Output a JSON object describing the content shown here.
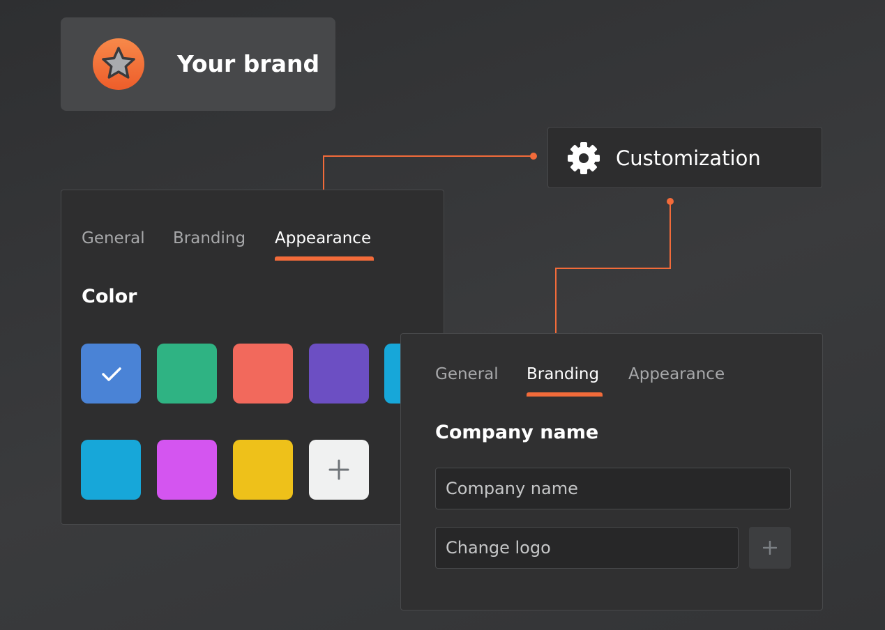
{
  "brand": {
    "name": "Your brand",
    "logo_icon": "star-icon",
    "logo_color": "#f26b3a"
  },
  "customization": {
    "label": "Customization",
    "icon": "gear-icon"
  },
  "accent_color": "#f26b3a",
  "appearance_panel": {
    "tabs": [
      {
        "label": "General",
        "active": false
      },
      {
        "label": "Branding",
        "active": false
      },
      {
        "label": "Appearance",
        "active": true
      }
    ],
    "section_title": "Color",
    "swatches": [
      {
        "color": "#4a83d6",
        "selected": true
      },
      {
        "color": "#2fb383"
      },
      {
        "color": "#f2695c"
      },
      {
        "color": "#6c4fc3"
      },
      {
        "color": "#17a7d9"
      },
      {
        "color": "#17a7d9"
      },
      {
        "color": "#d455f0"
      },
      {
        "color": "#eec11a"
      }
    ],
    "add_swatch_icon": "plus-icon"
  },
  "branding_panel": {
    "tabs": [
      {
        "label": "General",
        "active": false
      },
      {
        "label": "Branding",
        "active": true
      },
      {
        "label": "Appearance",
        "active": false
      }
    ],
    "section_title": "Company name",
    "company_name_placeholder": "Company name",
    "change_logo_placeholder": "Change logo",
    "add_logo_icon": "plus-icon"
  }
}
